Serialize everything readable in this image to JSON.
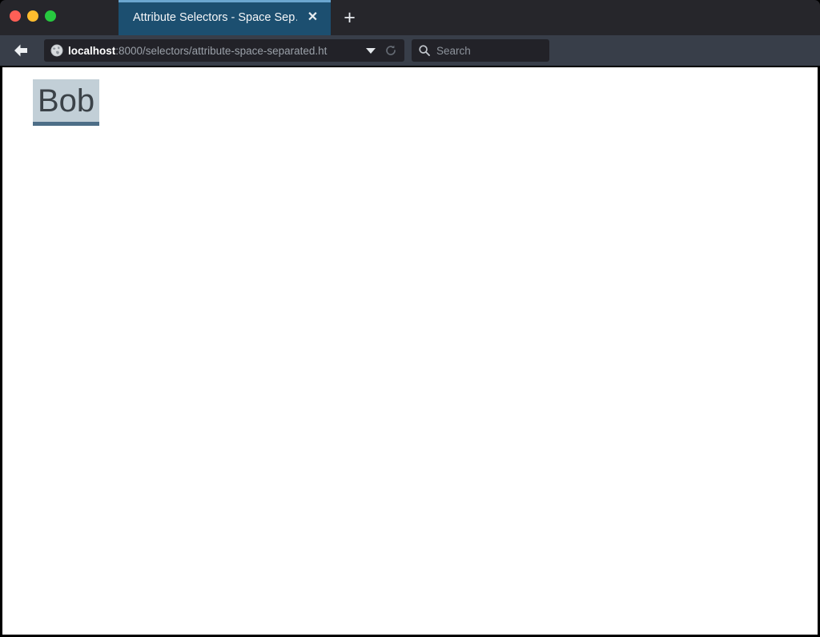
{
  "window": {
    "controls": [
      {
        "name": "close",
        "color": "#ff5f56"
      },
      {
        "name": "minimize",
        "color": "#febc2e"
      },
      {
        "name": "maximize",
        "color": "#27c93f"
      }
    ]
  },
  "tabs": [
    {
      "title": "Attribute Selectors - Space Sep…",
      "close_label": "✕",
      "active": true
    }
  ],
  "newtab": {
    "label": "+"
  },
  "navigation": {
    "back_label": "←",
    "url": {
      "host": "localhost",
      "path": ":8000/selectors/attribute-space-separated.ht",
      "full": "localhost:8000/selectors/attribute-space-separated.html",
      "dropdown_label": "▾",
      "reload_label": "⟳",
      "identity_icon": "globe-icon"
    }
  },
  "search": {
    "placeholder": "Search",
    "icon": "search-icon",
    "value": ""
  },
  "toolbar": {
    "icons": [
      {
        "name": "wrench-icon",
        "title": "Developer Tools"
      },
      {
        "name": "star-icon",
        "title": "Bookmark this page"
      },
      {
        "name": "clipboard-icon",
        "title": "Show your bookmarks"
      },
      {
        "name": "download-arrow-icon",
        "title": "Downloads",
        "color": "#4aa3e8"
      },
      {
        "name": "home-icon",
        "title": "Home"
      },
      {
        "name": "smiley-chat-icon",
        "title": "Submit feedback"
      },
      {
        "name": "pocket-icon",
        "title": "Save to Pocket"
      },
      {
        "name": "hamburger-menu-icon",
        "title": "Open menu"
      }
    ]
  },
  "page": {
    "elements": [
      {
        "text": "Bob",
        "background": "#c2cfd7",
        "border_bottom_color": "#4d6e87",
        "text_color": "#3b4248"
      }
    ]
  }
}
